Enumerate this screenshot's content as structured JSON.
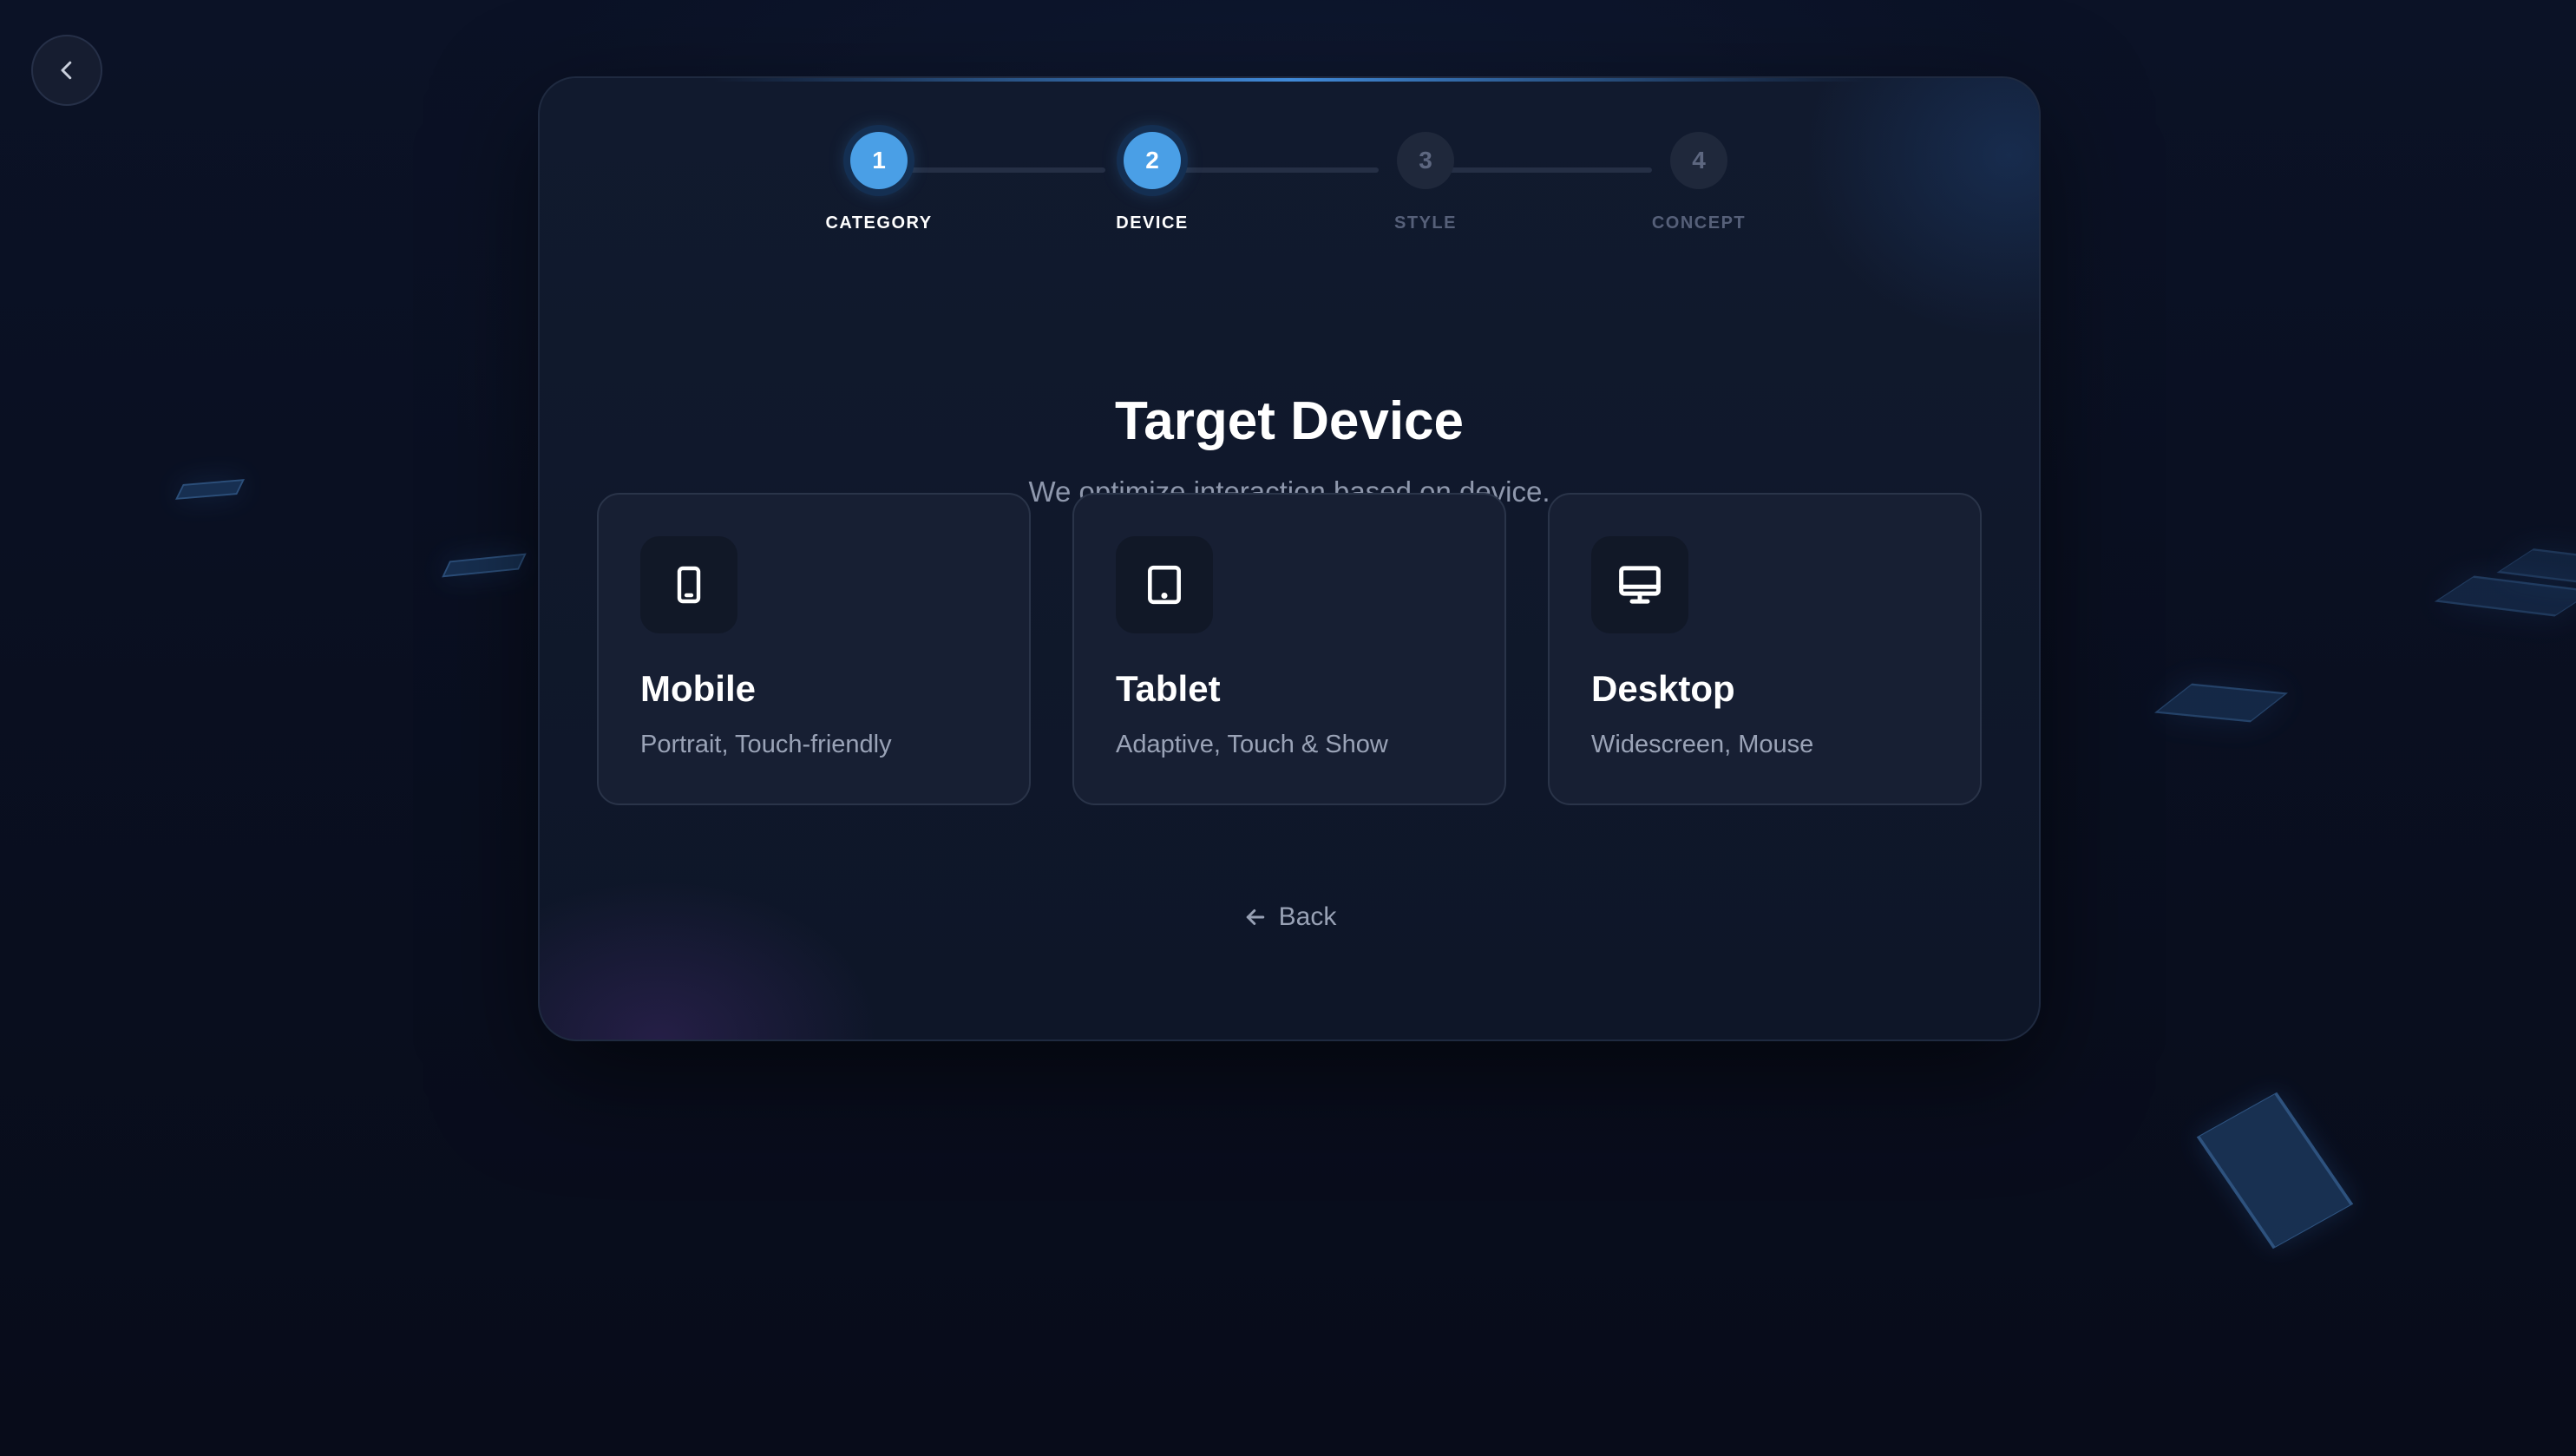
{
  "steps": [
    {
      "number": "1",
      "label": "CATEGORY",
      "state": "active"
    },
    {
      "number": "2",
      "label": "DEVICE",
      "state": "active"
    },
    {
      "number": "3",
      "label": "STYLE",
      "state": "inactive"
    },
    {
      "number": "4",
      "label": "CONCEPT",
      "state": "inactive"
    }
  ],
  "heading": {
    "title": "Target Device",
    "subtitle": "We optimize interaction based on device."
  },
  "options": [
    {
      "icon": "mobile-icon",
      "title": "Mobile",
      "description": "Portrait, Touch-friendly"
    },
    {
      "icon": "tablet-icon",
      "title": "Tablet",
      "description": "Adaptive, Touch & Show"
    },
    {
      "icon": "desktop-icon",
      "title": "Desktop",
      "description": "Widescreen, Mouse"
    }
  ],
  "footer": {
    "back_label": "Back",
    "back_icon": "arrow-left-icon"
  },
  "top_nav": {
    "back_icon": "chevron-left-icon"
  },
  "colors": {
    "accent": "#4a9fe6",
    "background": "#0a0f1f",
    "card": "#111a2e",
    "option_card": "#171f33"
  }
}
